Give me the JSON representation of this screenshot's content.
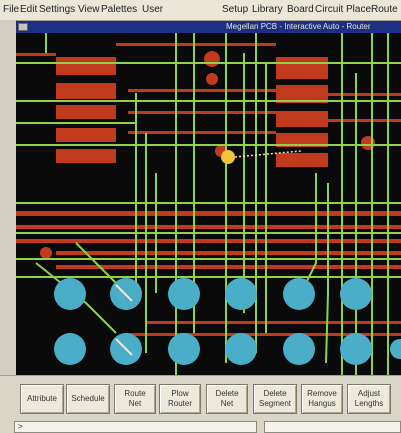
{
  "menubar": {
    "items": [
      "File",
      "Edit",
      "Settings",
      "View",
      "Palettes",
      "User"
    ],
    "right_items": [
      "Setup",
      "Library",
      "Board",
      "Circuit",
      "Place",
      "Route"
    ]
  },
  "window": {
    "title": "Megellan PCB - Interactive Auto - Router"
  },
  "toolbar": {
    "buttons": [
      {
        "line1": "Attribute",
        "line2": ""
      },
      {
        "line1": "Schedule",
        "line2": ""
      },
      {
        "line1": "Route",
        "line2": "Net"
      },
      {
        "line1": "Plow",
        "line2": "Router"
      },
      {
        "line1": "Delete",
        "line2": "Net"
      },
      {
        "line1": "Delete",
        "line2": "Segment"
      },
      {
        "line1": "Remove",
        "line2": "Hangus"
      },
      {
        "line1": "Adjust",
        "line2": "Lengths"
      }
    ]
  },
  "command_line": {
    "prompt": ">"
  },
  "colors": {
    "board_bg": "#0a0a0a",
    "copper_red": "#c23a1e",
    "trace_green": "#8fd24a",
    "pad_cyan": "#4aaec8",
    "highlight_yellow": "#f5c43a"
  }
}
